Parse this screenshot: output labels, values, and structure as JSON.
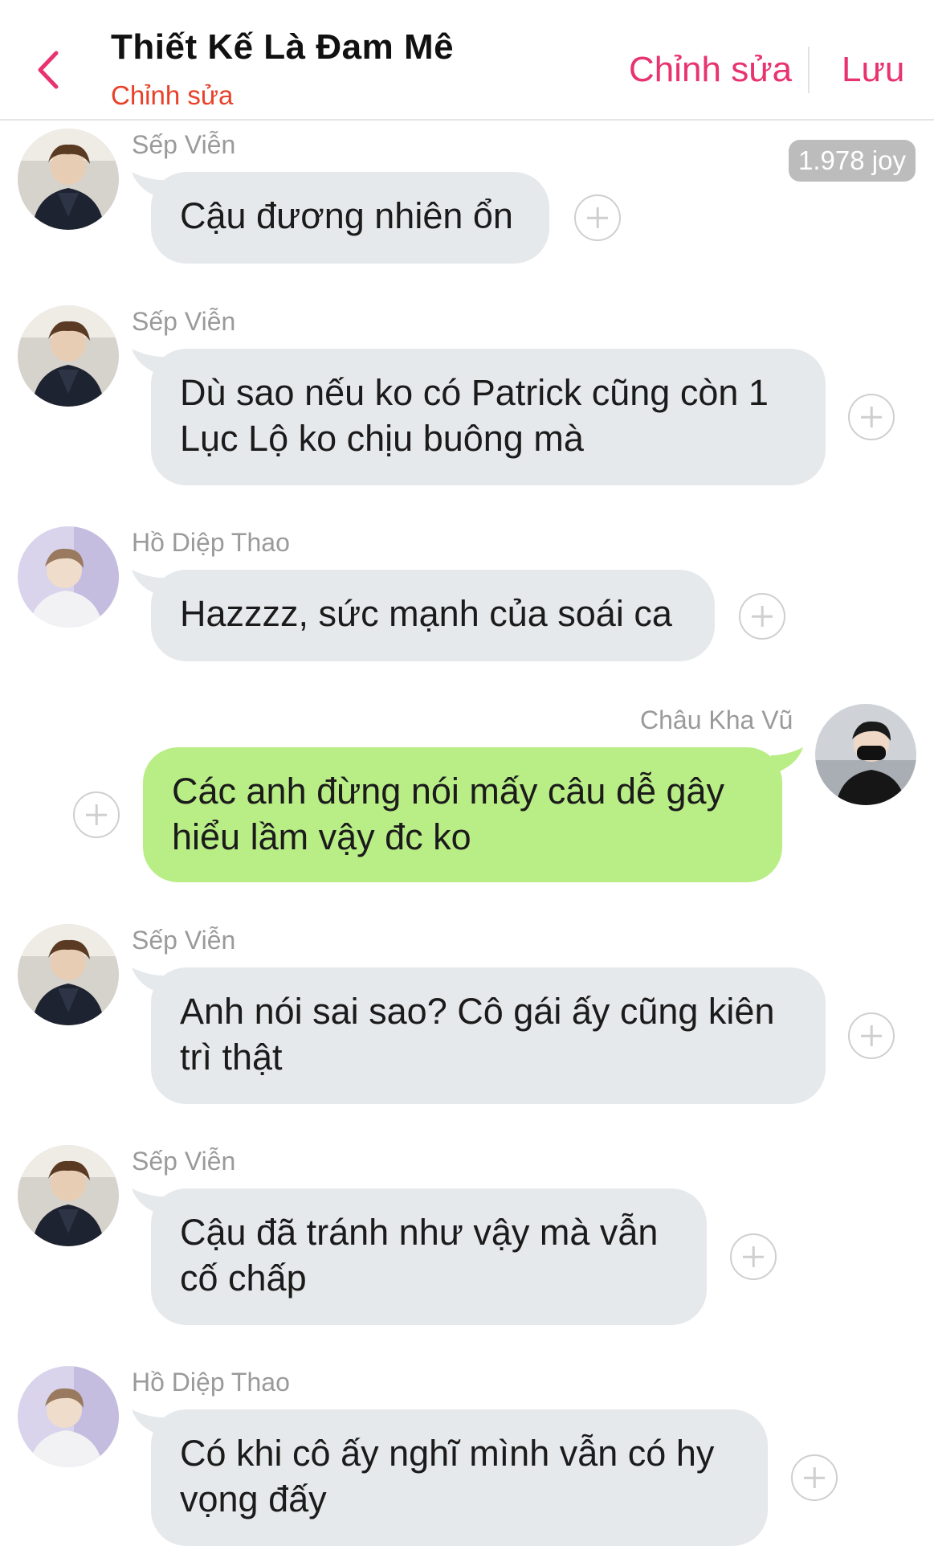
{
  "header": {
    "title": "Thiết Kế Là Đam Mê",
    "subtitle": "Chỉnh sửa",
    "edit_label": "Chỉnh sửa",
    "save_label": "Lưu",
    "back_icon": "chevron-left-icon",
    "accent_color": "#e8336e"
  },
  "balance": {
    "label": "1.978 joy"
  },
  "messages": [
    {
      "sender": "Sếp Viễn",
      "lines": [
        "Cậu đương nhiên ổn"
      ],
      "mine": false
    },
    {
      "sender": "Sếp Viễn",
      "lines": [
        "Dù sao nếu ko có Patrick cũng còn 1",
        "Lục Lộ ko chịu buông mà"
      ],
      "mine": false
    },
    {
      "sender": "Hồ Diệp Thao",
      "lines": [
        "Hazzzz, sức mạnh của soái ca"
      ],
      "mine": false
    },
    {
      "sender": "Châu Kha Vũ",
      "lines": [
        "Các anh đừng nói mấy câu dễ gây",
        "hiểu lầm vậy đc ko"
      ],
      "mine": true
    },
    {
      "sender": "Sếp Viễn",
      "lines": [
        "Anh nói sai sao? Cô gái ấy cũng kiên",
        "trì thật"
      ],
      "mine": false
    },
    {
      "sender": "Sếp Viễn",
      "lines": [
        "Cậu đã tránh như vậy mà vẫn",
        "cố chấp"
      ],
      "mine": false
    },
    {
      "sender": "Hồ Diệp Thao",
      "lines": [
        "Có khi cô ấy nghĩ mình vẫn có hy",
        "vọng đấy"
      ],
      "mine": false
    }
  ],
  "colors": {
    "bubble_other": "#e6e9eb",
    "bubble_mine": "#b9ed86",
    "sender_text": "#9a9a9a"
  }
}
